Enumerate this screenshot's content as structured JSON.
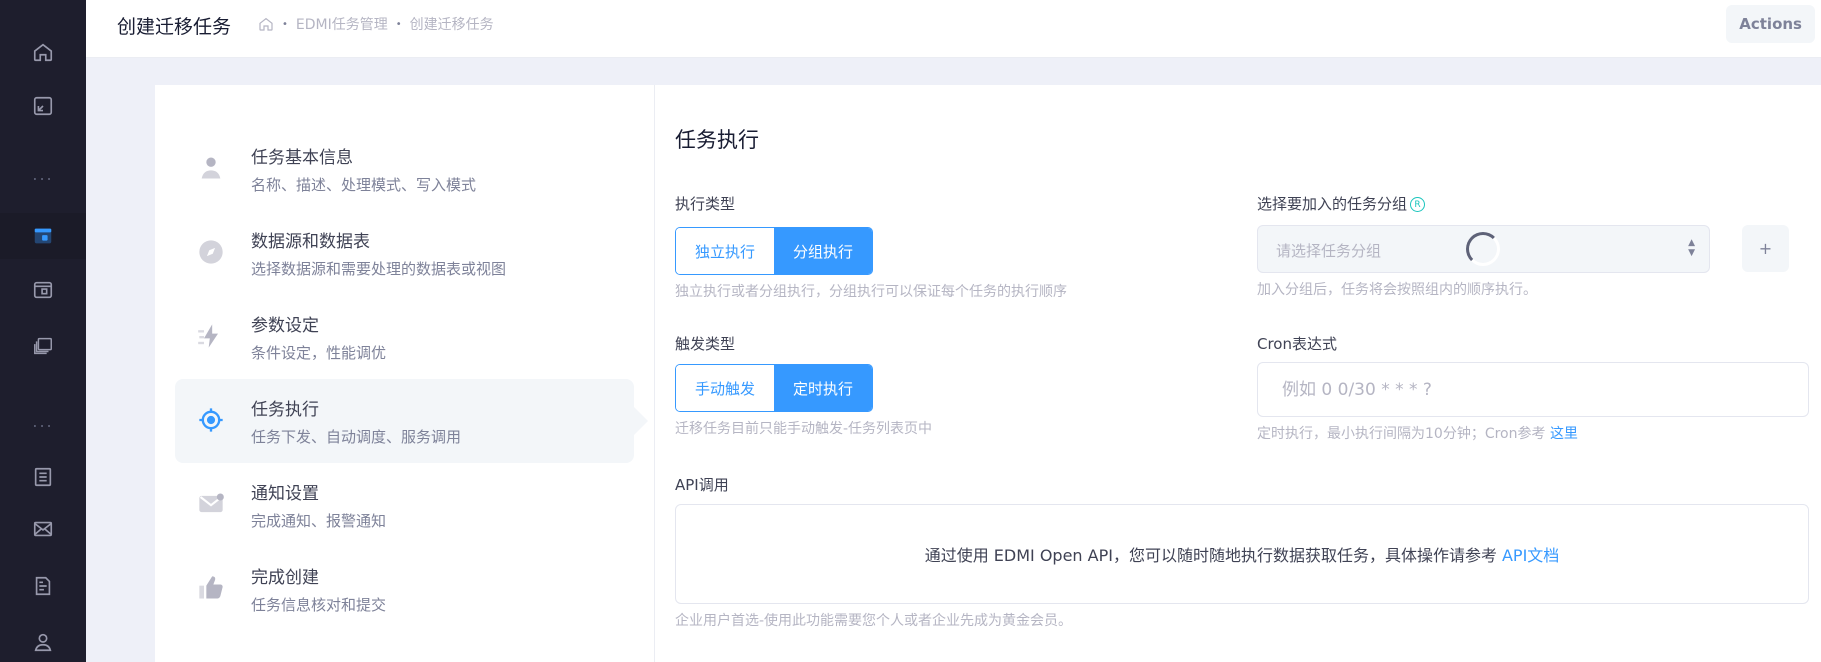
{
  "header": {
    "title": "创建迁移任务",
    "breadcrumb": {
      "items": [
        "EDMI任务管理",
        "创建迁移任务"
      ],
      "separator": "•"
    },
    "actions_label": "Actions"
  },
  "rail": {
    "icons": [
      "home-icon",
      "frame-icon",
      "layout-icon",
      "layout-icon",
      "layers-icon",
      "list-icon",
      "mail-icon",
      "file-icon",
      "user-icon"
    ],
    "dots": "..."
  },
  "steps": [
    {
      "title": "任务基本信息",
      "desc": "名称、描述、处理模式、写入模式",
      "icon": "user-icon"
    },
    {
      "title": "数据源和数据表",
      "desc": "选择数据源和需要处理的数据表或视图",
      "icon": "compass-icon"
    },
    {
      "title": "参数设定",
      "desc": "条件设定，性能调优",
      "icon": "thunder-icon"
    },
    {
      "title": "任务执行",
      "desc": "任务下发、自动调度、服务调用",
      "icon": "target-icon",
      "active": true
    },
    {
      "title": "通知设置",
      "desc": "完成通知、报警通知",
      "icon": "mail-icon"
    },
    {
      "title": "完成创建",
      "desc": "任务信息核对和提交",
      "icon": "thumbs-up-icon"
    }
  ],
  "form": {
    "section_title": "任务执行",
    "exec_type": {
      "label": "执行类型",
      "options": [
        "独立执行",
        "分组执行"
      ],
      "selected": "分组执行",
      "hint": "独立执行或者分组执行，分组执行可以保证每个任务的执行顺序"
    },
    "group": {
      "label": "选择要加入的任务分组",
      "info_icon": "R",
      "placeholder": "请选择任务分组",
      "add_label": "+",
      "hint": "加入分组后，任务将会按照组内的顺序执行。"
    },
    "trigger_type": {
      "label": "触发类型",
      "options": [
        "手动触发",
        "定时执行"
      ],
      "selected": "定时执行",
      "hint": "迁移任务目前只能手动触发-任务列表页中"
    },
    "cron": {
      "label": "Cron表达式",
      "placeholder": "例如 0 0/30 * * * ?",
      "hint": "定时执行，最小执行间隔为10分钟；Cron参考",
      "hint_link": "这里"
    },
    "api": {
      "label": "API调用",
      "text": "通过使用 EDMI Open API，您可以随时随地执行数据获取任务，具体操作请参考",
      "link": "API文档",
      "hint": "企业用户首选-使用此功能需要您个人或者企业先成为黄金会员。"
    }
  },
  "colors": {
    "primary": "#3699ff",
    "rail": "#1e1e2d",
    "muted": "#b5b5c3"
  }
}
